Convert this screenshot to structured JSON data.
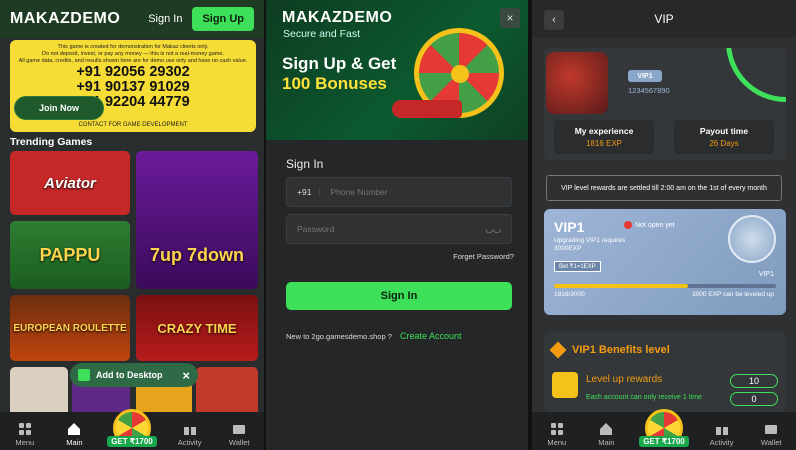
{
  "panel1": {
    "brand": "MAKAZDEMO",
    "sign_in": "Sign In",
    "sign_up": "Sign Up",
    "notice_lines": [
      "This game is created for demonstration for Makaz clients only.",
      "Do not deposit, invest, or pay any money — this is not a real-money game.",
      "All game data, credits, and results shown here are for demo use only and have no cash value."
    ],
    "phones": [
      "+91 92056 29302",
      "+91 90137 91029",
      "+91 92204 44779"
    ],
    "join": "Join Now",
    "contact": "CONTACT FOR GAME DEVELOPMENT",
    "trending": "Trending Games",
    "games": [
      "Aviator",
      "7up 7down",
      "PAPPU",
      "",
      "EUROPEAN ROULETTE",
      "CRAZY TIME",
      "",
      "",
      ""
    ],
    "add_desktop": "Add to Desktop",
    "nav": {
      "menu": "Menu",
      "main": "Main",
      "get": "GET ₹1700",
      "activity": "Activity",
      "wallet": "Wallet"
    }
  },
  "panel2": {
    "brand": "MAKAZDEMO",
    "tagline": "Secure and Fast",
    "promo1": "Sign Up & Get",
    "promo2": "100 Bonuses",
    "close": "×",
    "signin_title": "Sign In",
    "country_code": "+91",
    "phone_placeholder": "Phone Number",
    "password_placeholder": "Password",
    "forgot": "Forget Password?",
    "signin_button": "Sign In",
    "new_to": "New to 2go.gamesdemo.shop ?",
    "create": "Create Account"
  },
  "panel3": {
    "title": "VIP",
    "back": "‹",
    "badge": "VIP1",
    "uid": "1234567890",
    "exp_label": "My experience",
    "exp_value": "1816 EXP",
    "payout_label": "Payout time",
    "payout_value": "26 Days",
    "notice": "VIP level rewards are settled till 2:00 am on the 1st of every month",
    "vip_title": "VIP1",
    "not_open": "Not open yet",
    "upgrade": "Upgrading VIP1 requires 3000EXP",
    "bet": "Bet ₹1=1EXP",
    "vip_right": "VIP1",
    "progress": 0.605,
    "progress_left": "1816/3000",
    "progress_right": "3000 EXP can be leveled up",
    "benefits_title": "VIP1 Benefits level",
    "reward_label": "Level up rewards",
    "reward_sub": "Each account can only receive 1 time",
    "reward_value1": "10",
    "reward_value2": "0",
    "nav": {
      "menu": "Menu",
      "main": "Main",
      "get": "GET ₹1700",
      "activity": "Activity",
      "wallet": "Wallet"
    }
  },
  "colors": {
    "accent": "#3ee05a",
    "notice_bg": "#f6dd36",
    "gold": "#f39c12",
    "vip_blue": "#8aa6c9"
  }
}
